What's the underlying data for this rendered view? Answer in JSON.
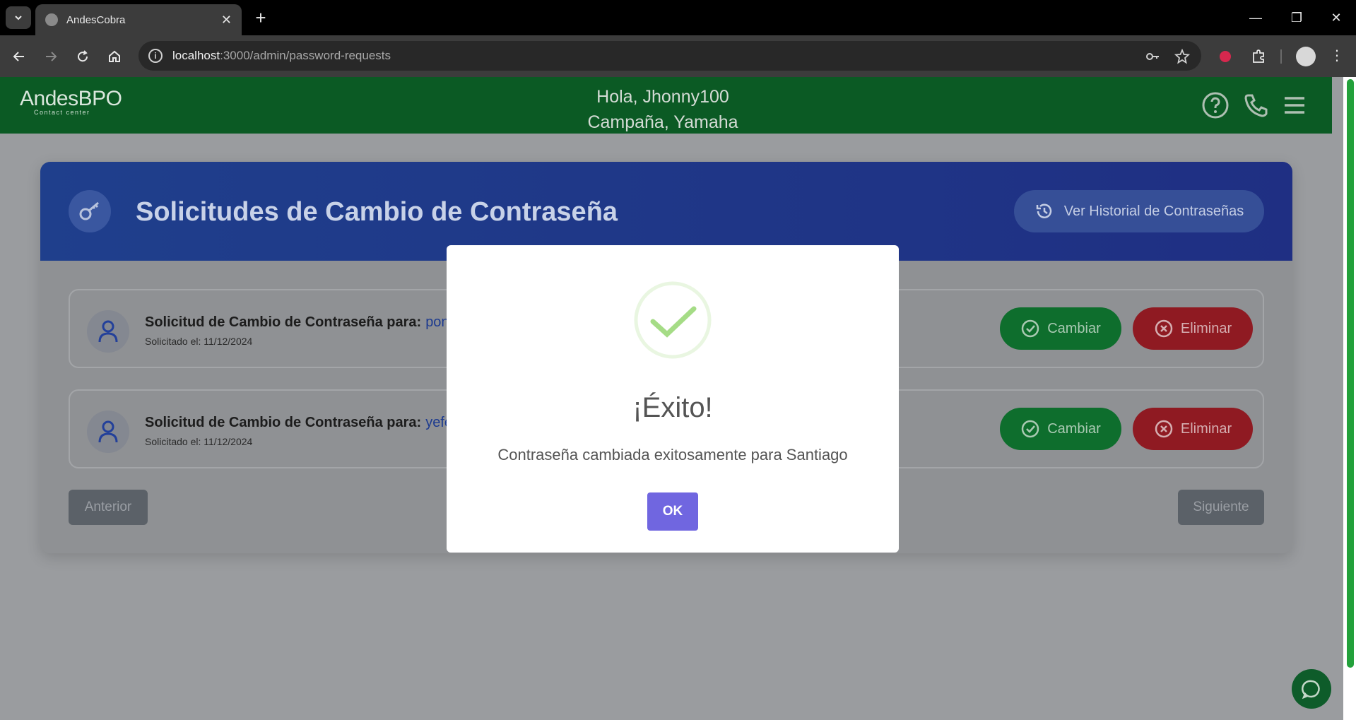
{
  "browser": {
    "tab_title": "AndesCobra",
    "url_host": "localhost",
    "url_path": ":3000/admin/password-requests"
  },
  "header": {
    "logo_main": "AndesBPO",
    "logo_sub": "Contact center",
    "greeting_line1": "Hola, Jhonny100",
    "greeting_line2": "Campaña, Yamaha",
    "icons": [
      "help-icon",
      "phone-icon",
      "menu-icon"
    ]
  },
  "card": {
    "title": "Solicitudes de Cambio de Contraseña",
    "history_button": "Ver Historial de Contraseñas",
    "requests": [
      {
        "label": "Solicitud de Cambio de Contraseña para:",
        "user": "pony",
        "date": "Solicitado el: 11/12/2024",
        "change_label": "Cambiar",
        "delete_label": "Eliminar"
      },
      {
        "label": "Solicitud de Cambio de Contraseña para:",
        "user": "yefer",
        "date": "Solicitado el: 11/12/2024",
        "change_label": "Cambiar",
        "delete_label": "Eliminar"
      }
    ],
    "prev_label": "Anterior",
    "next_label": "Siguiente"
  },
  "modal": {
    "title": "¡Éxito!",
    "text": "Contraseña cambiada exitosamente para Santiago",
    "ok_label": "OK"
  },
  "colors": {
    "header_green": "#0b5a24",
    "card_blue": "#1f3f8c",
    "ok_purple": "#7066e0",
    "success_green": "#a5dc86"
  }
}
